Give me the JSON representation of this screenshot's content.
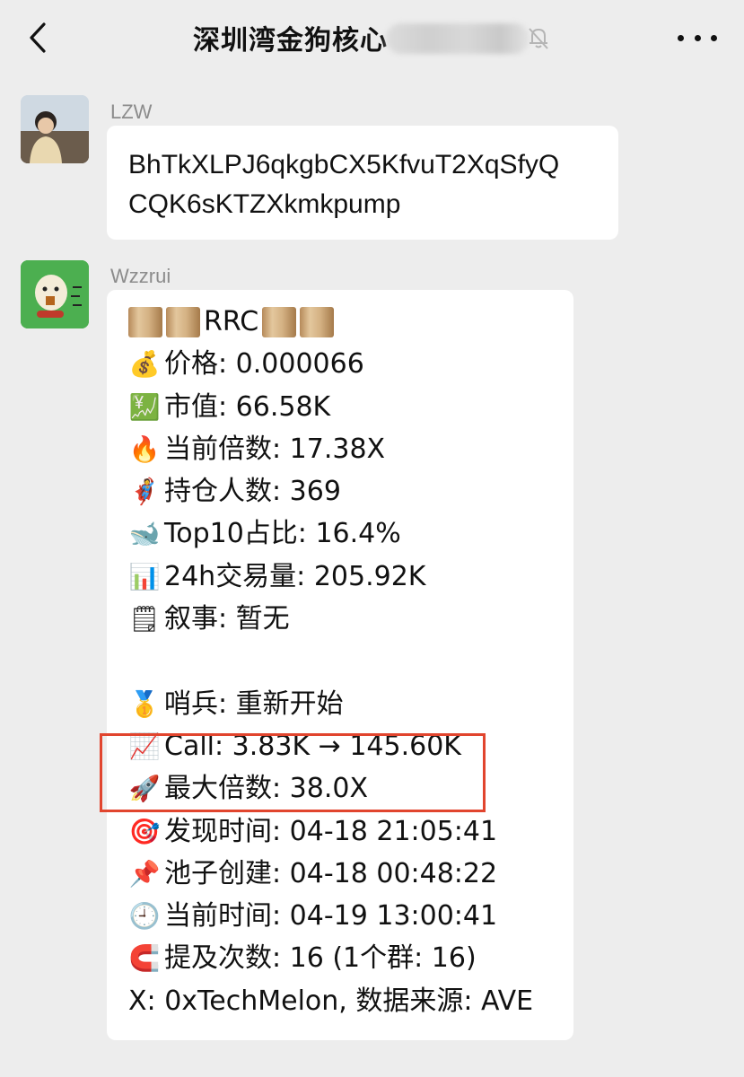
{
  "header": {
    "title": "深圳湾金狗核心",
    "back_icon": "chevron-left-icon",
    "mute_icon": "bell-off-icon",
    "more_icon": "more-dots-icon"
  },
  "messages": [
    {
      "sender": "LZW",
      "text": "BhTkXLPJ6qkgbCX5KfvuT2XqSfyQ\nCQK6sKTZXkmkpump"
    },
    {
      "sender": "Wzzrui",
      "lines": [
        {
          "icon": "scroll-icon",
          "glyph": "",
          "text": "RRC"
        },
        {
          "icon": "money-bag-icon",
          "glyph": "💰",
          "text": "价格: 0.000066"
        },
        {
          "icon": "yen-chart-icon",
          "glyph": "💹",
          "text": "市值: 66.58K"
        },
        {
          "icon": "fire-icon",
          "glyph": "🔥",
          "text": "当前倍数: 17.38X"
        },
        {
          "icon": "superhero-icon",
          "glyph": "🦸",
          "text": "持仓人数: 369"
        },
        {
          "icon": "whale-icon",
          "glyph": "🐋",
          "text": "Top10占比: 16.4%"
        },
        {
          "icon": "bar-chart-icon",
          "glyph": "📊",
          "text": "24h交易量: 205.92K"
        },
        {
          "icon": "notepad-icon",
          "glyph": "🗒",
          "text": "叙事: 暂无"
        },
        {
          "icon": "",
          "glyph": "",
          "text": ""
        },
        {
          "icon": "medal-icon",
          "glyph": "🥇",
          "text": "哨兵: 重新开始"
        },
        {
          "icon": "chart-up-icon",
          "glyph": "📈",
          "text": "Call: 3.83K → 145.60K"
        },
        {
          "icon": "rocket-icon",
          "glyph": "🚀",
          "text": "最大倍数: 38.0X"
        },
        {
          "icon": "target-icon",
          "glyph": "🎯",
          "text": "发现时间: 04-18 21:05:41"
        },
        {
          "icon": "pushpin-icon",
          "glyph": "📌",
          "text": "池子创建: 04-18 00:48:22"
        },
        {
          "icon": "clock-icon",
          "glyph": "🕘",
          "text": "当前时间: 04-19 13:00:41"
        },
        {
          "icon": "magnet-icon",
          "glyph": "🧲",
          "text": "提及次数: 16 (1个群: 16)"
        },
        {
          "icon": "",
          "glyph": "",
          "text": "X: 0xTechMelon, 数据来源: AVE"
        }
      ]
    }
  ],
  "colors": {
    "background": "#ededed",
    "bubble": "#ffffff",
    "highlight_box": "#e1452e",
    "sender_name": "#8c8c8c"
  }
}
